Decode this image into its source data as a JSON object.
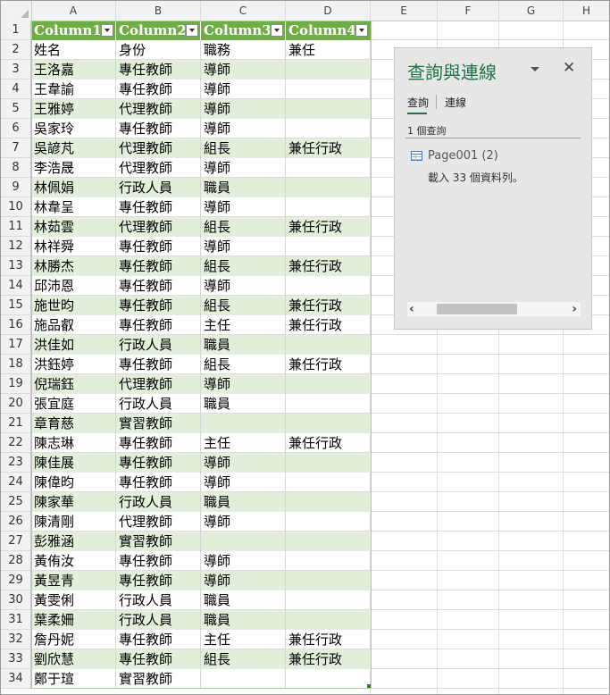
{
  "columns": [
    "A",
    "B",
    "C",
    "D",
    "E",
    "F",
    "G",
    "H"
  ],
  "row_numbers": [
    "1",
    "2",
    "3",
    "4",
    "5",
    "6",
    "7",
    "8",
    "9",
    "10",
    "11",
    "12",
    "13",
    "14",
    "15",
    "16",
    "17",
    "18",
    "19",
    "20",
    "21",
    "22",
    "23",
    "24",
    "25",
    "26",
    "27",
    "28",
    "29",
    "30",
    "31",
    "32",
    "33",
    "34"
  ],
  "table": {
    "headers": [
      "Column1",
      "Column2",
      "Column3",
      "Column4"
    ],
    "style_colors": {
      "header": "#70ad47",
      "band": "#e2efda",
      "border": "#a9d08e"
    },
    "rows": [
      [
        "姓名",
        "身份",
        "職務",
        "兼任"
      ],
      [
        "王洛嘉",
        "專任教師",
        "導師",
        ""
      ],
      [
        "王韋諭",
        "專任教師",
        "導師",
        ""
      ],
      [
        "王雅婷",
        "代理教師",
        "導師",
        ""
      ],
      [
        "吳家玲",
        "專任教師",
        "導師",
        ""
      ],
      [
        "吳諺芃",
        "代理教師",
        "組長",
        "兼任行政"
      ],
      [
        "李浩晟",
        "代理教師",
        "導師",
        ""
      ],
      [
        "林佩娟",
        "行政人員",
        "職員",
        ""
      ],
      [
        "林韋呈",
        "專任教師",
        "導師",
        ""
      ],
      [
        "林茹雲",
        "代理教師",
        "組長",
        "兼任行政"
      ],
      [
        "林祥舜",
        "專任教師",
        "導師",
        ""
      ],
      [
        "林勝杰",
        "專任教師",
        "組長",
        "兼任行政"
      ],
      [
        "邱沛恩",
        "專任教師",
        "導師",
        ""
      ],
      [
        "施世昀",
        "專任教師",
        "組長",
        "兼任行政"
      ],
      [
        "施品叡",
        "專任教師",
        "主任",
        "兼任行政"
      ],
      [
        "洪佳如",
        "行政人員",
        "職員",
        ""
      ],
      [
        "洪鈺婷",
        "專任教師",
        "組長",
        "兼任行政"
      ],
      [
        "倪瑞鈺",
        "代理教師",
        "導師",
        ""
      ],
      [
        "張宜庭",
        "行政人員",
        "職員",
        ""
      ],
      [
        "章育慈",
        "實習教師",
        "",
        ""
      ],
      [
        "陳志琳",
        "專任教師",
        "主任",
        "兼任行政"
      ],
      [
        "陳佳展",
        "專任教師",
        "導師",
        ""
      ],
      [
        "陳偉昀",
        "專任教師",
        "導師",
        ""
      ],
      [
        "陳家華",
        "行政人員",
        "職員",
        ""
      ],
      [
        "陳清剛",
        "代理教師",
        "導師",
        ""
      ],
      [
        "彭雅涵",
        "實習教師",
        "",
        ""
      ],
      [
        "黃侑汝",
        "專任教師",
        "導師",
        ""
      ],
      [
        "黃昱青",
        "專任教師",
        "導師",
        ""
      ],
      [
        "黃雯俐",
        "行政人員",
        "職員",
        ""
      ],
      [
        "葉柔姍",
        "行政人員",
        "職員",
        ""
      ],
      [
        "詹丹妮",
        "專任教師",
        "主任",
        "兼任行政"
      ],
      [
        "劉欣慧",
        "專任教師",
        "組長",
        "兼任行政"
      ],
      [
        "鄭于瑄",
        "實習教師",
        "",
        ""
      ]
    ]
  },
  "pane": {
    "title": "查詢與連線",
    "tabs": [
      "查詢",
      "連線"
    ],
    "active_tab": "查詢",
    "count": "1 個查詢",
    "query": {
      "name": "Page001 (2)",
      "status": "載入 33 個資料列。"
    },
    "icons": {
      "menu": "chevron-down-icon",
      "close": "close-icon",
      "query": "table-icon",
      "scroll_left": "chevron-left-icon",
      "scroll_right": "chevron-right-icon"
    }
  }
}
